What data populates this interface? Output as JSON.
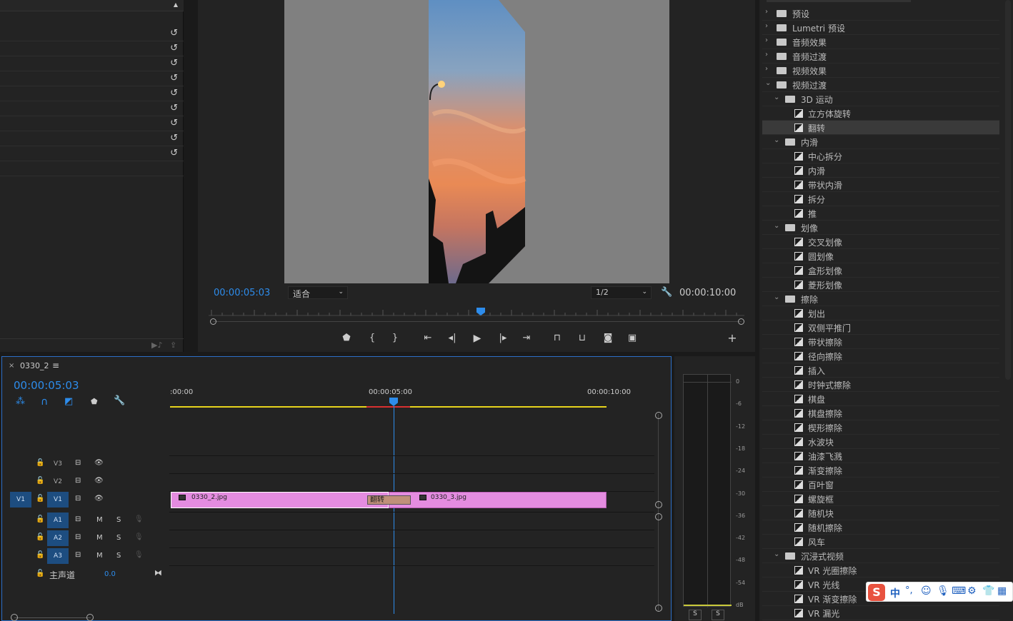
{
  "program": {
    "current_time": "00:00:05:03",
    "zoom": "适合",
    "resolution": "1/2",
    "duration": "00:00:10:00"
  },
  "timeline": {
    "sequence_name": "0330_2",
    "current_time": "00:00:05:03",
    "ruler": [
      ":00:00",
      "00:00:05:00",
      "00:00:10:00"
    ],
    "tracks": [
      {
        "source": "",
        "target": "V3",
        "type": "video"
      },
      {
        "source": "",
        "target": "V2",
        "type": "video"
      },
      {
        "source": "V1",
        "target": "V1",
        "type": "video"
      },
      {
        "source": "",
        "target": "A1",
        "type": "audio"
      },
      {
        "source": "",
        "target": "A2",
        "type": "audio"
      },
      {
        "source": "",
        "target": "A3",
        "type": "audio"
      }
    ],
    "master_label": "主声道",
    "master_value": "0.0",
    "mute_label": "M",
    "solo_label": "S",
    "clips": [
      {
        "name": "0330_2.jpg",
        "color": "#e48ce0"
      },
      {
        "name": "0330_3.jpg",
        "color": "#e48ce0"
      }
    ],
    "transition_label": "翻转"
  },
  "meter": {
    "scale": [
      "0",
      "-6",
      "-12",
      "-18",
      "-24",
      "-30",
      "-36",
      "-42",
      "-48",
      "-54",
      "dB"
    ],
    "solo_buttons": [
      "S",
      "S"
    ]
  },
  "effects": {
    "items": [
      {
        "label": "预设",
        "level": 0,
        "kind": "folder",
        "open": false
      },
      {
        "label": "Lumetri 预设",
        "level": 0,
        "kind": "folder",
        "open": false
      },
      {
        "label": "音频效果",
        "level": 0,
        "kind": "folder",
        "open": false
      },
      {
        "label": "音频过渡",
        "level": 0,
        "kind": "folder",
        "open": false
      },
      {
        "label": "视频效果",
        "level": 0,
        "kind": "folder",
        "open": false
      },
      {
        "label": "视频过渡",
        "level": 0,
        "kind": "folder",
        "open": true
      },
      {
        "label": "3D 运动",
        "level": 1,
        "kind": "folder",
        "open": true
      },
      {
        "label": "立方体旋转",
        "level": 2,
        "kind": "effect"
      },
      {
        "label": "翻转",
        "level": 2,
        "kind": "effect",
        "selected": true
      },
      {
        "label": "内滑",
        "level": 1,
        "kind": "folder",
        "open": true
      },
      {
        "label": "中心拆分",
        "level": 2,
        "kind": "effect"
      },
      {
        "label": "内滑",
        "level": 2,
        "kind": "effect"
      },
      {
        "label": "带状内滑",
        "level": 2,
        "kind": "effect"
      },
      {
        "label": "拆分",
        "level": 2,
        "kind": "effect"
      },
      {
        "label": "推",
        "level": 2,
        "kind": "effect"
      },
      {
        "label": "划像",
        "level": 1,
        "kind": "folder",
        "open": true
      },
      {
        "label": "交叉划像",
        "level": 2,
        "kind": "effect"
      },
      {
        "label": "圆划像",
        "level": 2,
        "kind": "effect"
      },
      {
        "label": "盒形划像",
        "level": 2,
        "kind": "effect"
      },
      {
        "label": "菱形划像",
        "level": 2,
        "kind": "effect"
      },
      {
        "label": "擦除",
        "level": 1,
        "kind": "folder",
        "open": true
      },
      {
        "label": "划出",
        "level": 2,
        "kind": "effect"
      },
      {
        "label": "双侧平推门",
        "level": 2,
        "kind": "effect"
      },
      {
        "label": "带状擦除",
        "level": 2,
        "kind": "effect"
      },
      {
        "label": "径向擦除",
        "level": 2,
        "kind": "effect"
      },
      {
        "label": "插入",
        "level": 2,
        "kind": "effect"
      },
      {
        "label": "时钟式擦除",
        "level": 2,
        "kind": "effect"
      },
      {
        "label": "棋盘",
        "level": 2,
        "kind": "effect"
      },
      {
        "label": "棋盘擦除",
        "level": 2,
        "kind": "effect"
      },
      {
        "label": "楔形擦除",
        "level": 2,
        "kind": "effect"
      },
      {
        "label": "水波块",
        "level": 2,
        "kind": "effect"
      },
      {
        "label": "油漆飞溅",
        "level": 2,
        "kind": "effect"
      },
      {
        "label": "渐变擦除",
        "level": 2,
        "kind": "effect"
      },
      {
        "label": "百叶窗",
        "level": 2,
        "kind": "effect"
      },
      {
        "label": "螺旋框",
        "level": 2,
        "kind": "effect"
      },
      {
        "label": "随机块",
        "level": 2,
        "kind": "effect"
      },
      {
        "label": "随机擦除",
        "level": 2,
        "kind": "effect"
      },
      {
        "label": "风车",
        "level": 2,
        "kind": "effect"
      },
      {
        "label": "沉浸式视频",
        "level": 1,
        "kind": "folder",
        "open": true
      },
      {
        "label": "VR 光圈擦除",
        "level": 2,
        "kind": "effect"
      },
      {
        "label": "VR 光线",
        "level": 2,
        "kind": "effect"
      },
      {
        "label": "VR 渐变擦除",
        "level": 2,
        "kind": "effect"
      },
      {
        "label": "VR 漏光",
        "level": 2,
        "kind": "effect"
      }
    ]
  },
  "ime": {
    "label": "中"
  }
}
